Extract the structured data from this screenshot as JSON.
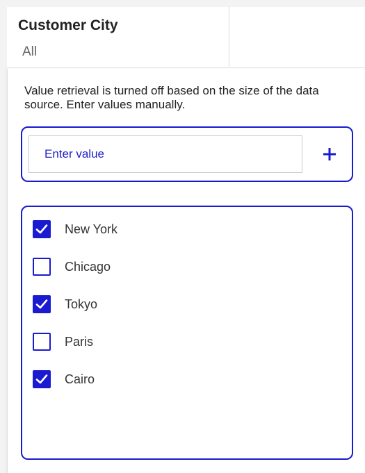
{
  "filter": {
    "title": "Customer City",
    "value": "All"
  },
  "panel": {
    "info": "Value retrieval is turned off based on the size of the data source. Enter values manually.",
    "input": {
      "placeholder": "Enter value",
      "value": ""
    },
    "add_icon": "plus-icon",
    "items": [
      {
        "label": "New York",
        "checked": true
      },
      {
        "label": "Chicago",
        "checked": false
      },
      {
        "label": "Tokyo",
        "checked": true
      },
      {
        "label": "Paris",
        "checked": false
      },
      {
        "label": "Cairo",
        "checked": true
      }
    ]
  },
  "colors": {
    "accent": "#1a1ad0",
    "text": "#222222",
    "muted": "#666666"
  }
}
